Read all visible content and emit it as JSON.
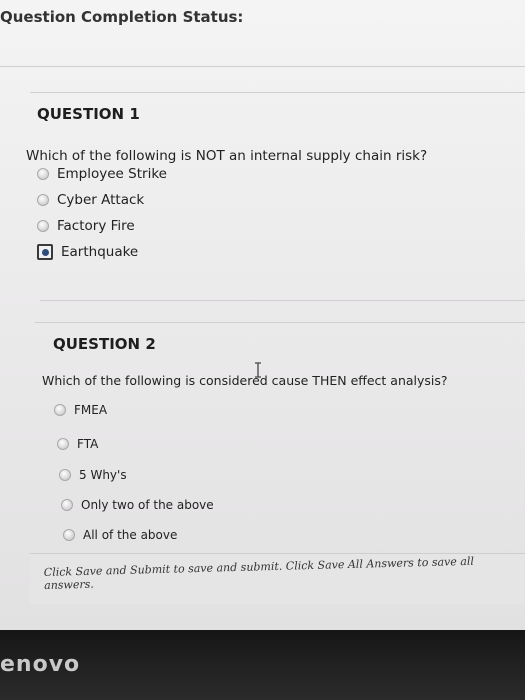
{
  "status": {
    "title": "Question Completion Status:"
  },
  "question1": {
    "title": "QUESTION 1",
    "text": "Which of the following is NOT an internal supply chain risk?",
    "options": [
      {
        "label": "Employee Strike",
        "selected": false
      },
      {
        "label": "Cyber Attack",
        "selected": false
      },
      {
        "label": "Factory Fire",
        "selected": false
      },
      {
        "label": "Earthquake",
        "selected": true
      }
    ]
  },
  "question2": {
    "title": "QUESTION 2",
    "text": "Which of the following is considered cause THEN effect analysis?",
    "options": [
      {
        "label": "FMEA",
        "selected": false
      },
      {
        "label": "FTA",
        "selected": false
      },
      {
        "label": "5 Why's",
        "selected": false
      },
      {
        "label": "Only two of the above",
        "selected": false
      },
      {
        "label": "All of the above",
        "selected": false
      }
    ]
  },
  "footer": {
    "instructions": "Click Save and Submit to save and submit. Click Save All Answers to save all answers."
  },
  "bezel": {
    "brand": "enovo"
  }
}
